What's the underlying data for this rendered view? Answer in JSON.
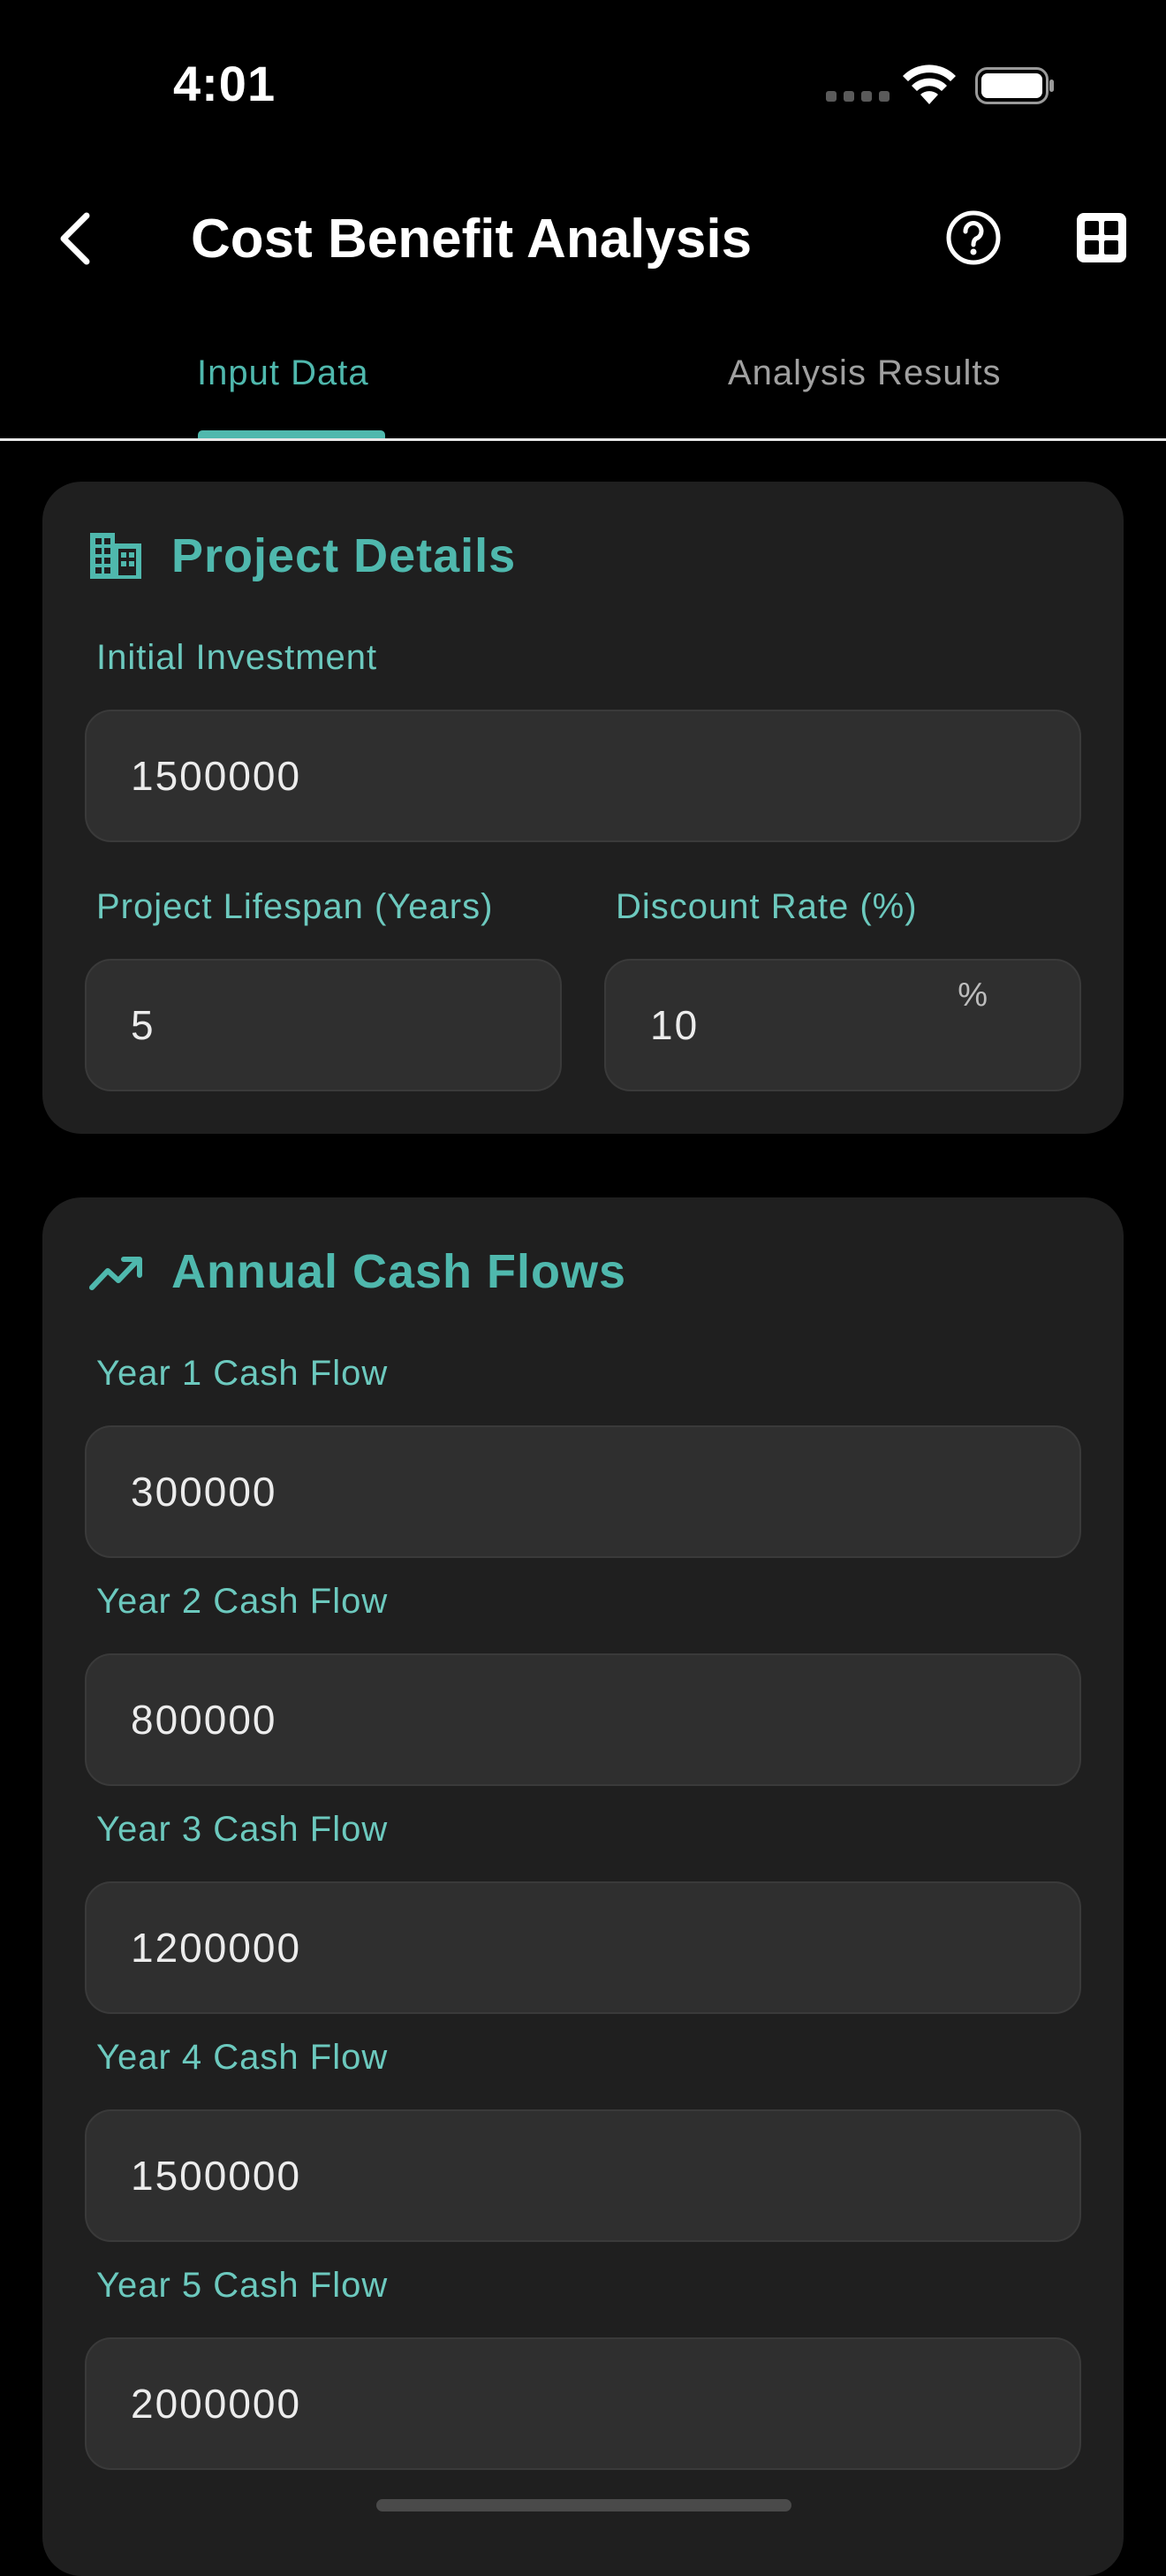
{
  "status_bar": {
    "time": "4:01"
  },
  "app_bar": {
    "title": "Cost Benefit Analysis"
  },
  "tabs": [
    {
      "label": "Input Data",
      "active": true
    },
    {
      "label": "Analysis Results",
      "active": false
    }
  ],
  "project_details": {
    "title": "Project Details",
    "icon": "building-icon",
    "initial_investment": {
      "label": "Initial Investment",
      "value": "1500000"
    },
    "lifespan": {
      "label": "Project Lifespan (Years)",
      "value": "5"
    },
    "discount_rate": {
      "label": "Discount Rate (%)",
      "value": "10",
      "suffix": "%"
    }
  },
  "cash_flows": {
    "title": "Annual Cash Flows",
    "icon": "trending-up-icon",
    "items": [
      {
        "label": "Year 1 Cash Flow",
        "value": "300000"
      },
      {
        "label": "Year 2 Cash Flow",
        "value": "800000"
      },
      {
        "label": "Year 3 Cash Flow",
        "value": "1200000"
      },
      {
        "label": "Year 4 Cash Flow",
        "value": "1500000"
      },
      {
        "label": "Year 5 Cash Flow",
        "value": "2000000"
      }
    ]
  },
  "colors": {
    "accent": "#4fb8ad",
    "card": "#1f1f1f",
    "field": "#2f2f2f",
    "background": "#000000"
  }
}
